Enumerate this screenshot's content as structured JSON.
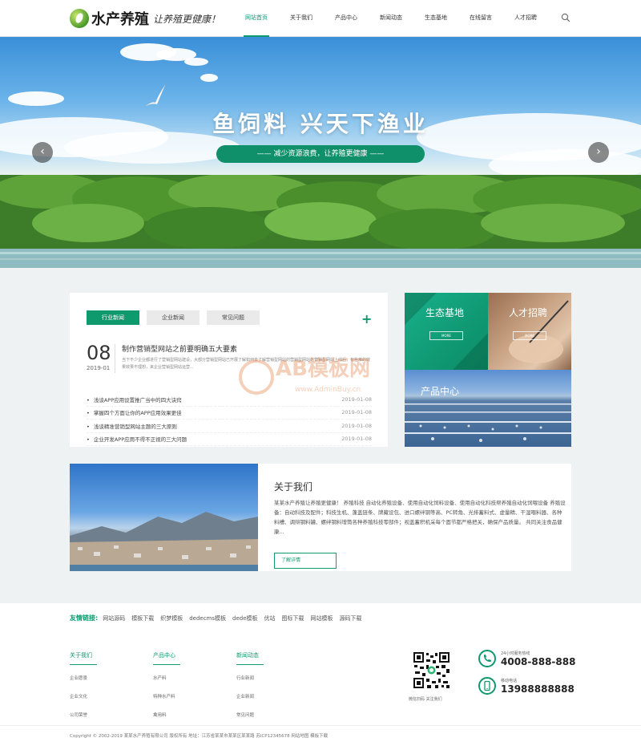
{
  "header": {
    "logo_text": "水产养殖",
    "slogan": "让养殖更健康！",
    "nav": [
      "网站首页",
      "关于我们",
      "产品中心",
      "新闻动态",
      "生态基地",
      "在线留言",
      "人才招聘"
    ],
    "active_index": 0
  },
  "banner": {
    "title": "鱼饲料  兴天下渔业",
    "subtitle": "—— 减少资源浪费，让养殖更健康 ——",
    "prev": "‹",
    "next": "›"
  },
  "news": {
    "tabs": [
      "行业新闻",
      "企业新闻",
      "常见问题"
    ],
    "more": "+",
    "feature": {
      "day": "08",
      "year_month": "2019-01",
      "title": "制作营销型网站之前要明确五大要素",
      "desc": "当下不少企业都进行了营销型网站建设，大部分营销型网站已开展了解如何去了解营销型网站的营销型网站的营销型网站上线后，有些难的效果效果不理想，来企业营销型网站运营..."
    },
    "items": [
      {
        "title": "浅谈APP应用设置推广当中的四大诀窍",
        "date": "2019-01-08"
      },
      {
        "title": "掌握四个方面让你的APP应用效果更佳",
        "date": "2019-01-08"
      },
      {
        "title": "浅谈精准营销型网站主题的三大原则",
        "date": "2019-01-08"
      },
      {
        "title": "企业开发APP应用不得不正视的三大问题",
        "date": "2019-01-08"
      }
    ]
  },
  "tiles": {
    "base": {
      "label": "生态基地",
      "btn": "MORE"
    },
    "recruit": {
      "label": "人才招聘",
      "btn": "MORE"
    },
    "products": {
      "label": "产品中心"
    }
  },
  "watermark": {
    "text": "AB模板网",
    "url": "www.AdminBuy.cn"
  },
  "about": {
    "title": "关于我们",
    "text": "某某水产养殖让养殖更健康！ 养殖科技 自动化养殖设备、使用自动化饲料设备、使用自动化科技帮养殖自动化饲喂设备 养殖设备：自动科技及配件；科技生机、蓬盖链条、牌藏设包、进口螺绊钢等高、PC转角、光排蓄料式、虚量精、干湿喂料器、各种料槽、调辩钢料罐、螺绊钢料增筒各种养殖科技零部件；视盖蓄积机采每个面节都严格把关，确保产品质量。 共同关注食品健康...",
    "button": "了解详情"
  },
  "footer": {
    "friends_label": "友情链接:",
    "friends": [
      "网站源码",
      "模板下载",
      "织梦模板",
      "dedecms模板",
      "dede模板",
      "优站",
      "图标下载",
      "网站模板",
      "源码下载"
    ],
    "cols": [
      {
        "title": "关于我们",
        "items": [
          "企业愿景",
          "企业文化",
          "公司荣誉"
        ]
      },
      {
        "title": "产品中心",
        "items": [
          "水产料",
          "特种水产料",
          "禽用料"
        ]
      },
      {
        "title": "新闻动态",
        "items": [
          "行业新闻",
          "企业新闻",
          "常见问题"
        ]
      }
    ],
    "qr_caption": "微信扫码 关注我们",
    "hotline_label": "24小时服务热线",
    "hotline": "4008-888-888",
    "mobile_label": "移动电话",
    "mobile": "13988888888",
    "copyright": "Copyright © 2002-2019 某某水产养殖有限公司 版权所有   地址：江苏省某某市某某区某某路   苏ICP12345678   网站地图   模板下载"
  },
  "colors": {
    "accent": "#0f9a6e"
  }
}
